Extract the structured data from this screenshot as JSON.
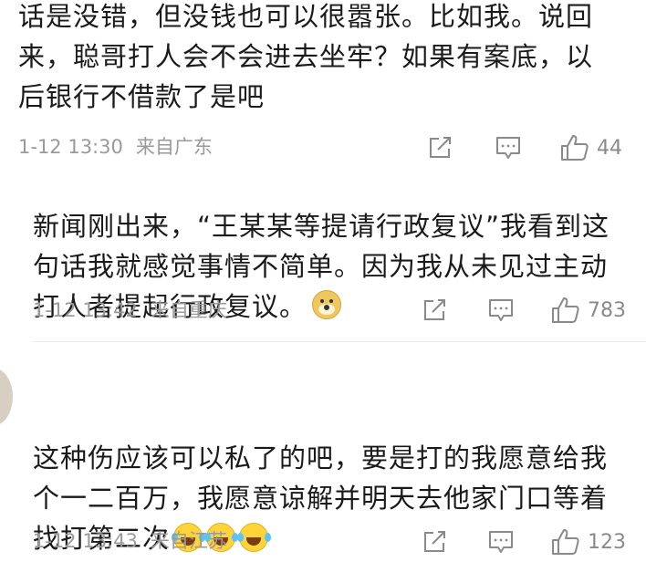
{
  "comments": [
    {
      "text": "话是没错，但没钱也可以很嚣张。比如我。说回\n来，聪哥打人会不会进去坐牢？如果有案底，以\n后银行不借款了是吧",
      "time": "1-12 13:30",
      "source": "来自广东",
      "likes": "44"
    },
    {
      "text": "新闻刚出来，“王某某等提请行政复议”我看到这\n句话我就感觉事情不简单。因为我从未见过主动\n打人者提起行政复议。",
      "emoji": "doge-emoji",
      "time": "1-12 13:42",
      "source": "来自重庆",
      "likes": "783"
    },
    {
      "text": "这种伤应该可以私了的吧，要是打的我愿意给我\n个一二百万，我愿意谅解并明天去他家门口等着\n找打第二次",
      "emoji": "laughing-tears-emoji",
      "time": "1-12 13:43",
      "source": "来自江苏",
      "likes": "123"
    }
  ],
  "icons": {
    "share": "share-icon",
    "comment": "comment-icon",
    "like": "thumbs-up-icon"
  },
  "colors": {
    "text": "#1a1a1a",
    "meta": "#9a9a9a",
    "divider": "#ececec"
  }
}
